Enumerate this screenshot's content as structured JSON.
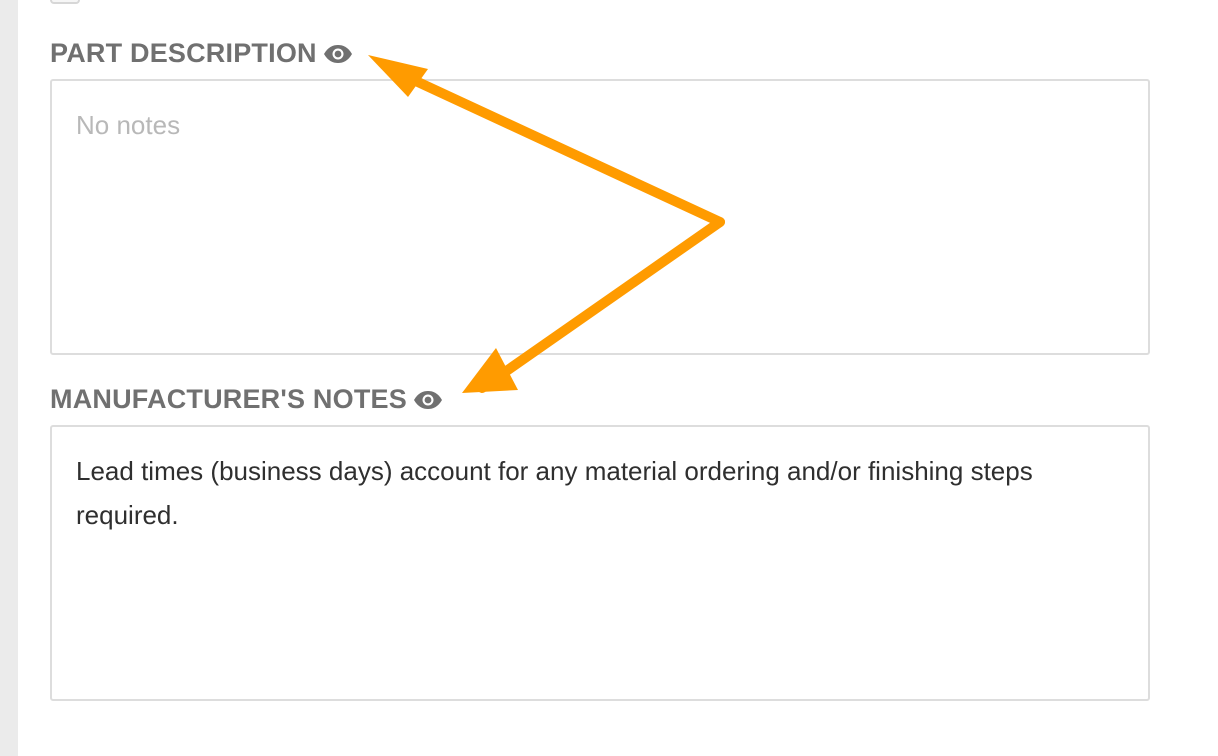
{
  "sections": [
    {
      "label": "PART DESCRIPTION",
      "icon": "eye-icon",
      "placeholder": "No notes",
      "value": ""
    },
    {
      "label": "MANUFACTURER'S NOTES",
      "icon": "eye-icon",
      "placeholder": "",
      "value": "Lead times (business days) account for any material ordering and/or finishing steps required."
    }
  ],
  "colors": {
    "label": "#707070",
    "field_border": "#dddddd",
    "placeholder": "#b8b8b8",
    "text": "#2f2f2f",
    "annotation": "#ff9b00"
  }
}
